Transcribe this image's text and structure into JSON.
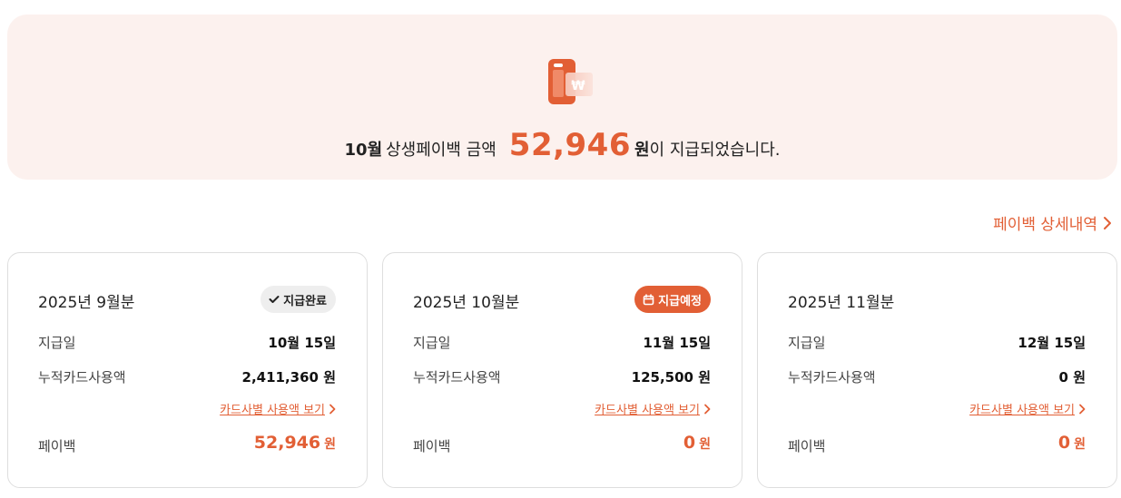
{
  "banner": {
    "icon": "payback-card-won-icon",
    "month": "10월",
    "text_before": "상생페이백 금액",
    "amount": "52,946",
    "won": "원",
    "text_after": "이 지급되었습니다."
  },
  "detail_link": {
    "label": "페이백 상세내역",
    "icon": "chevron-right-icon"
  },
  "cards": [
    {
      "title": "2025년 9월분",
      "badge": {
        "label": "지급완료",
        "icon": "check-icon"
      },
      "pay_date_label": "지급일",
      "pay_date": "10월 15일",
      "usage_label": "누적카드사용액",
      "usage": "2,411,360 원",
      "link": "카드사별 사용액 보기",
      "payback_label": "페이백",
      "payback": "52,946",
      "payback_unit": "원"
    },
    {
      "title": "2025년 10월분",
      "badge": {
        "label": "지급예정",
        "icon": "calendar-icon"
      },
      "pay_date_label": "지급일",
      "pay_date": "11월 15일",
      "usage_label": "누적카드사용액",
      "usage": "125,500 원",
      "link": "카드사별 사용액 보기",
      "payback_label": "페이백",
      "payback": "0",
      "payback_unit": "원"
    },
    {
      "title": "2025년 11월분",
      "pay_date_label": "지급일",
      "pay_date": "12월 15일",
      "usage_label": "누적카드사용액",
      "usage": "0 원",
      "link": "카드사별 사용액 보기",
      "payback_label": "페이백",
      "payback": "0",
      "payback_unit": "원"
    }
  ],
  "colors": {
    "accent": "#e25f35",
    "banner_bg": "#fcf1ee",
    "badge_done_bg": "#eeeeee"
  }
}
